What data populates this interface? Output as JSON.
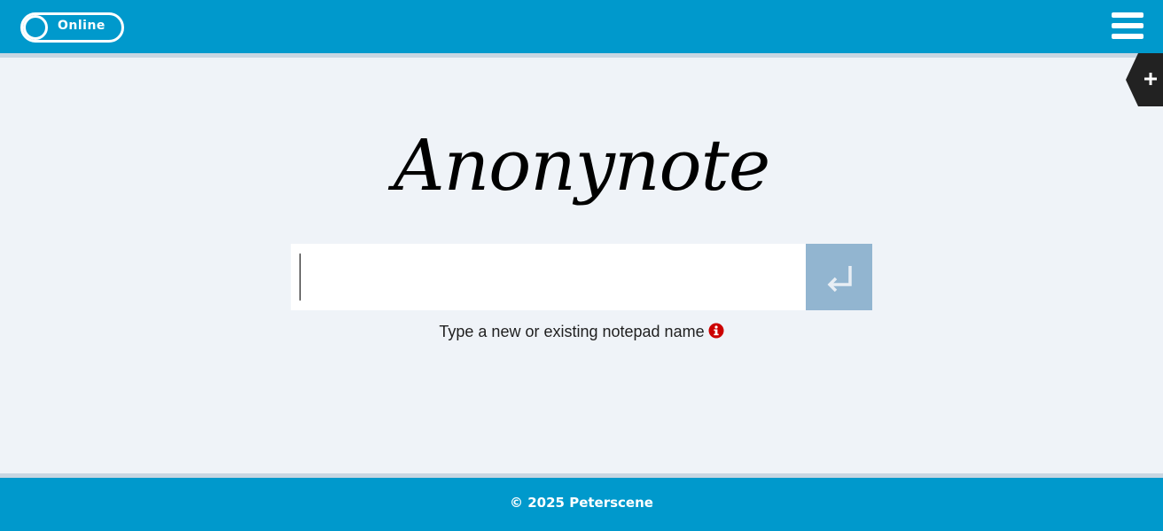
{
  "header": {
    "status_toggle": {
      "label": "Online",
      "state": "on"
    },
    "menu_icon": "hamburger-menu-icon",
    "color": "#0099cc"
  },
  "side_tab": {
    "icon": "plus-icon",
    "color": "#222222"
  },
  "main": {
    "app_title": "Anonynote",
    "notepad_input": {
      "value": "",
      "placeholder": ""
    },
    "submit_icon": "enter-return-icon",
    "submit_color": "#92b5d0",
    "hint_text": "Type a new or existing notepad name",
    "hint_icon": "info-icon",
    "hint_icon_color": "#cc0000"
  },
  "footer": {
    "copyright": "© 2025 Peterscene"
  }
}
